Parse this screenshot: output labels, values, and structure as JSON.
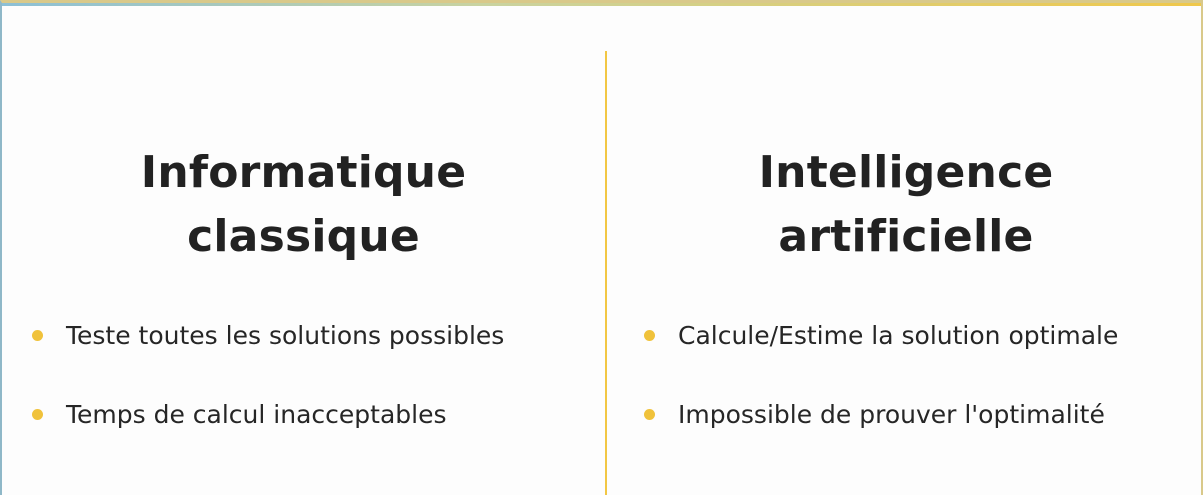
{
  "left": {
    "heading_line1": "Informatique",
    "heading_line2": "classique",
    "bullets": [
      "Teste toutes les solutions possibles",
      "Temps de calcul inacceptables"
    ]
  },
  "right": {
    "heading_line1": "Intelligence",
    "heading_line2": "artificielle",
    "bullets": [
      "Calcule/Estime la solution optimale",
      "Impossible de prouver l'optimalité"
    ]
  },
  "colors": {
    "accent": "#f0c23b",
    "divider": "#f2c744",
    "text": "#222222"
  }
}
